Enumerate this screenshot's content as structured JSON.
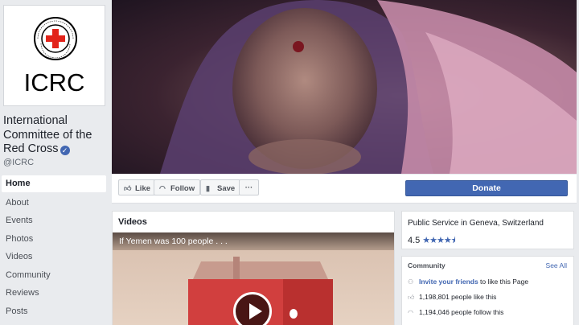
{
  "profile": {
    "logo_text": "ICRC",
    "logo_ring_text": "COMITE INTERNATIONAL GENEVE",
    "name": "International Committee of the Red Cross",
    "handle": "@ICRC"
  },
  "nav": {
    "items": [
      {
        "label": "Home",
        "active": true
      },
      {
        "label": "About"
      },
      {
        "label": "Events"
      },
      {
        "label": "Photos"
      },
      {
        "label": "Videos"
      },
      {
        "label": "Community"
      },
      {
        "label": "Reviews"
      },
      {
        "label": "Posts"
      }
    ]
  },
  "actions": {
    "like": "Like",
    "follow": "Follow",
    "save": "Save",
    "more": "···",
    "donate": "Donate"
  },
  "videos": {
    "title": "Videos",
    "caption": "If Yemen was 100 people . . ."
  },
  "info": {
    "category": "Public Service in Geneva, Switzerland",
    "rating": "4.5",
    "stars": "★★★★⯨"
  },
  "community": {
    "title": "Community",
    "see_all": "See All",
    "invite_link": "Invite your friends",
    "invite_rest": " to like this Page",
    "likes": "1,198,801 people like this",
    "follows": "1,194,046 people follow this"
  },
  "colors": {
    "accent": "#4267b2",
    "red_cross": "#e2231a",
    "background": "#e9ebee"
  },
  "icons": [
    "thumbs-up-icon",
    "rss-icon",
    "bookmark-icon",
    "verified-icon",
    "play-icon",
    "invite-icon",
    "like-icon",
    "follow-icon"
  ]
}
